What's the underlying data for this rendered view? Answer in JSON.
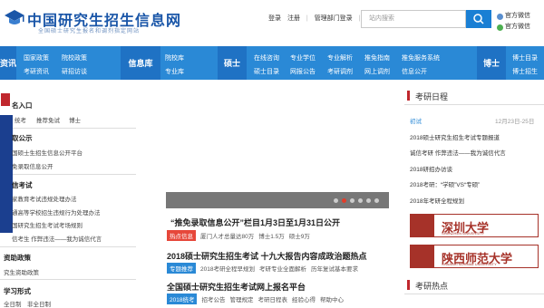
{
  "header": {
    "logo_title": "中国研究生招生信息网",
    "logo_sub": "全国硕士研究生报名和调剂指定网站",
    "login": "登录",
    "register": "注册",
    "admin": "管理部门登录",
    "search_placeholder": "站内搜索",
    "weibo": "官方微信",
    "wechat": "官方微信"
  },
  "nav": {
    "col1": [
      "国家政策",
      "考研资讯"
    ],
    "col2": [
      "院校政策",
      "研招访谈"
    ],
    "head1_left": "资讯",
    "head2": "信息库",
    "col3": [
      "院校库",
      "专业库"
    ],
    "head3": "硕士",
    "col4": [
      "在线咨询",
      "硕士目录"
    ],
    "col5": [
      "专业学位",
      "网报公告"
    ],
    "col6": [
      "专业解析",
      "考研调剂"
    ],
    "col7": [
      "推免指南",
      "网上调剂"
    ],
    "col8": [
      "推免服务系统",
      "信息公开"
    ],
    "head4": "博士",
    "col9": [
      "博士目录",
      "博士招生"
    ]
  },
  "sidebar": {
    "sec1_title": "名入口",
    "sec1_items": [
      "统考",
      "推荐免试",
      "博士"
    ],
    "sec2_title": "取公示",
    "sec2_items": [
      "国硕士生招生信息公开平台",
      "免录取信息公开"
    ],
    "sec3_title": "信考试",
    "sec3_items": [
      "家教育考试违规处理办法",
      "通高等学校招生违规行为处理办法",
      "国研究生招生考试考场规则",
      "信考生 作弊违法——我为诚信代言"
    ],
    "sec4_title": "资助政策",
    "sec4_items": [
      "究生资助政策"
    ],
    "sec5_title": "学习形式",
    "sec5_items": [
      "全日制",
      "非全日制"
    ]
  },
  "main": {
    "news1_title": "“推免录取信息公开”栏目1月3日至1月31日公开",
    "news1_tag": "热点信息",
    "news1_links": [
      "厦门人才总量达80万",
      "博士1.5万",
      "硕士9万"
    ],
    "news2_title": "2018硕士研究生招生考试 十九大报告内容成政治题热点",
    "news2_tag": "专题推荐",
    "news2_links": [
      "2018考研全程早规划",
      "考研专业全面解析",
      "历年复试基本要求"
    ],
    "news3_title": "全国硕士研究生招生考试网上报名平台",
    "news3_tag": "2018统考",
    "news3_links": [
      "招考公告",
      "管理规定",
      "考研日程表",
      "经验心得",
      "帮助中心"
    ]
  },
  "right": {
    "calendar_title": "考研日程",
    "first_item": "初试",
    "first_date": "12月23日-25日",
    "items": [
      "2018硕士研究生招生考试专题报道",
      "诚信考研 作弊违法——我为诚信代言",
      "2018研招办访谈",
      "2018考研：“学硕”VS“专硕”",
      "2018年考研全程规划"
    ],
    "uni1_name": "深圳大学",
    "uni1_sub": "SHENZHEN UNIVERSITY",
    "uni2_name": "陕西师范大学",
    "uni2_sub": "SHAANXI NORMAL UNIVERSITY",
    "hot_title": "考研热点"
  },
  "colors": {
    "brand": "#1a56a8",
    "nav": "#2a89d6",
    "accent_red": "#c0272d",
    "tag_red": "#e6473a",
    "tag_blue": "#2a89d6"
  }
}
